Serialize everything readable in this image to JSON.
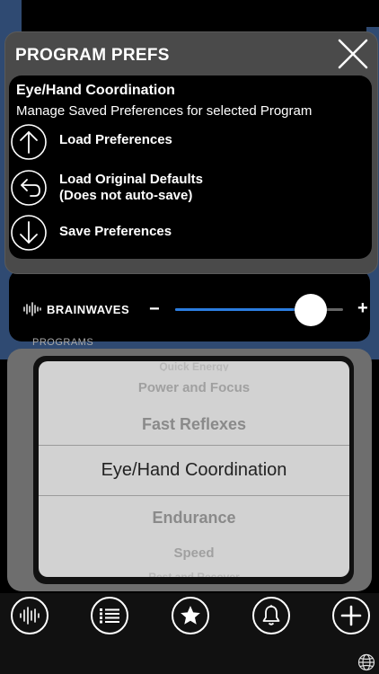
{
  "modal": {
    "title": "PROGRAM PREFS",
    "program_name": "Eye/Hand Coordination",
    "subtitle": "Manage Saved Preferences for selected Program",
    "options": [
      {
        "line1": "Load Preferences",
        "line2": "",
        "icon": "arrow-up-circle-icon"
      },
      {
        "line1": "Load Original Defaults",
        "line2": "(Does not auto-save)",
        "icon": "undo-arrow-circle-icon"
      },
      {
        "line1": "Save Preferences",
        "line2": "",
        "icon": "arrow-down-circle-icon"
      }
    ]
  },
  "brainwaves": {
    "label": "BRAINWAVES",
    "minus": "−",
    "plus": "+",
    "level_fraction": 0.81
  },
  "programs": {
    "label": "PROGRAMS",
    "items": [
      "Quick Energy",
      "Power and Focus",
      "Fast Reflexes",
      "Eye/Hand Coordination",
      "Endurance",
      "Speed",
      "Rest and Recover"
    ],
    "selected": "Eye/Hand Coordination"
  },
  "tabbar": {
    "icons": [
      "waveform-icon",
      "list-icon",
      "star-icon",
      "bell-icon",
      "plus-icon"
    ]
  },
  "colors": {
    "accent": "#2b7de0",
    "panel": "#2f4a72"
  }
}
